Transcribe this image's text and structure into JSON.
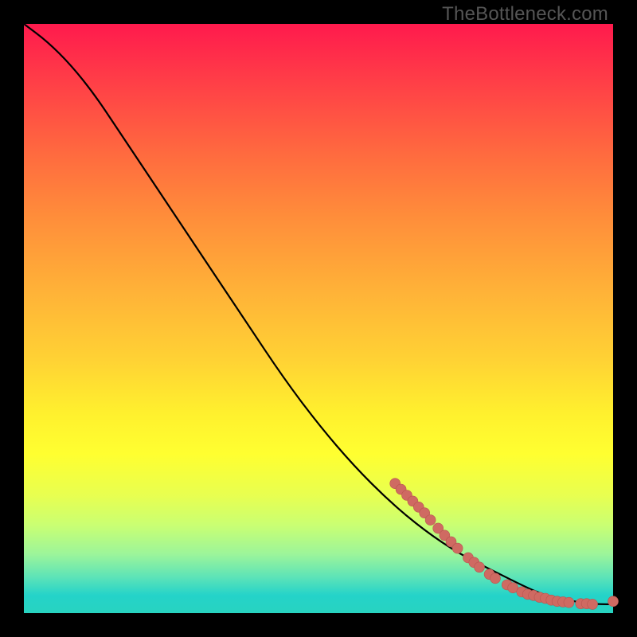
{
  "watermark": "TheBottleneck.com",
  "colors": {
    "background": "#000000",
    "curve": "#000000",
    "markers": "#cf6a62"
  },
  "chart_data": {
    "type": "line",
    "title": "",
    "xlabel": "",
    "ylabel": "",
    "xlim": [
      0,
      100
    ],
    "ylim": [
      0,
      100
    ],
    "grid": false,
    "legend": false,
    "series": [
      {
        "name": "curve",
        "x": [
          0,
          4,
          8,
          12,
          16,
          20,
          26,
          32,
          38,
          44,
          50,
          56,
          62,
          68,
          74,
          80,
          85,
          88,
          91,
          94,
          96,
          98,
          100
        ],
        "y": [
          100,
          97,
          93,
          88,
          82,
          76,
          67,
          58,
          49,
          40,
          32,
          25,
          19,
          14,
          10,
          7,
          4.5,
          3.2,
          2.4,
          1.9,
          1.6,
          1.5,
          1.5
        ]
      }
    ],
    "markers": [
      {
        "x": 63,
        "y": 22
      },
      {
        "x": 64,
        "y": 21
      },
      {
        "x": 65,
        "y": 20
      },
      {
        "x": 66,
        "y": 19
      },
      {
        "x": 67,
        "y": 18
      },
      {
        "x": 68,
        "y": 17
      },
      {
        "x": 69,
        "y": 15.8
      },
      {
        "x": 70.3,
        "y": 14.4
      },
      {
        "x": 71.4,
        "y": 13.2
      },
      {
        "x": 72.5,
        "y": 12.1
      },
      {
        "x": 73.6,
        "y": 11.0
      },
      {
        "x": 75.4,
        "y": 9.4
      },
      {
        "x": 76.4,
        "y": 8.6
      },
      {
        "x": 77.3,
        "y": 7.8
      },
      {
        "x": 79.0,
        "y": 6.6
      },
      {
        "x": 80.0,
        "y": 5.9
      },
      {
        "x": 82.0,
        "y": 4.8
      },
      {
        "x": 83.0,
        "y": 4.3
      },
      {
        "x": 84.5,
        "y": 3.6
      },
      {
        "x": 85.5,
        "y": 3.2
      },
      {
        "x": 86.5,
        "y": 3.0
      },
      {
        "x": 87.5,
        "y": 2.7
      },
      {
        "x": 88.5,
        "y": 2.5
      },
      {
        "x": 89.5,
        "y": 2.2
      },
      {
        "x": 90.5,
        "y": 2.0
      },
      {
        "x": 91.5,
        "y": 1.9
      },
      {
        "x": 92.5,
        "y": 1.8
      },
      {
        "x": 94.5,
        "y": 1.6
      },
      {
        "x": 95.5,
        "y": 1.6
      },
      {
        "x": 96.5,
        "y": 1.5
      },
      {
        "x": 100,
        "y": 2.0
      }
    ]
  }
}
